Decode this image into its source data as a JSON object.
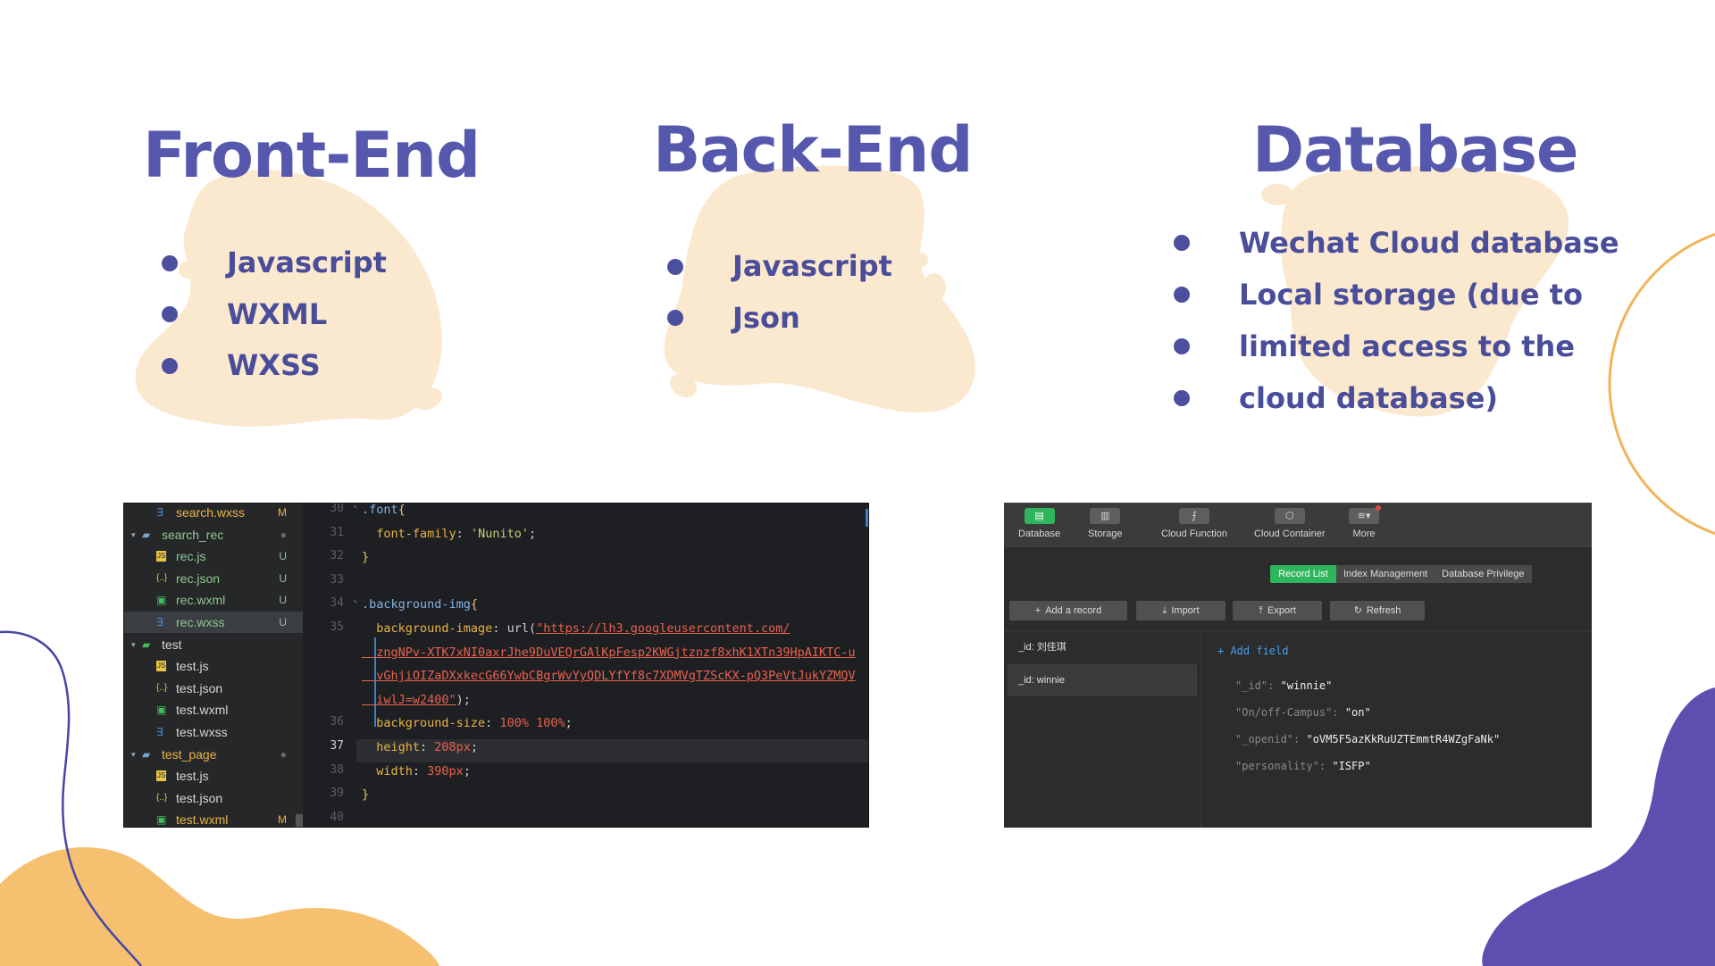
{
  "colors": {
    "heading": "#5558ad",
    "bullet_text": "#4a4d99",
    "blob": "#fbe9cf",
    "orange_blob": "#f5c06f",
    "purple_blob": "#5d4fb0",
    "line_blue": "#4746a7",
    "line_orange": "#f2b35a"
  },
  "sections": [
    {
      "title": "Front-End",
      "items": [
        "Javascript",
        "WXML",
        "WXSS"
      ]
    },
    {
      "title": "Back-End",
      "items": [
        "Javascript",
        "Json"
      ]
    },
    {
      "title": "Database",
      "items": [
        "Wechat Cloud database",
        "Local storage (due to",
        "limited access to the",
        "cloud database)"
      ]
    }
  ],
  "editor": {
    "tree": [
      {
        "name": "search.wxss",
        "icon": "css-file-icon",
        "glyph": "∃",
        "status": "M",
        "color": "#e9b545",
        "icon_color": "#4a8fe0",
        "indent": 1
      },
      {
        "name": "search_rec",
        "icon": "folder-icon",
        "glyph": "▰",
        "status": "●",
        "color": "#8ec98e",
        "icon_color": "#7aa6c9",
        "indent": 0,
        "arrow": "▾"
      },
      {
        "name": "rec.js",
        "icon": "js-file-icon",
        "glyph": "JS",
        "status": "U",
        "color": "#8ec98e",
        "icon_color": "#e9c545",
        "indent": 1
      },
      {
        "name": "rec.json",
        "icon": "json-file-icon",
        "glyph": "{..}",
        "status": "U",
        "color": "#8ec98e",
        "icon_color": "#e9c545",
        "indent": 1
      },
      {
        "name": "rec.wxml",
        "icon": "wxml-file-icon",
        "glyph": "▣",
        "status": "U",
        "color": "#8ec98e",
        "icon_color": "#3fbf5a",
        "indent": 1
      },
      {
        "name": "rec.wxss",
        "icon": "css-file-icon",
        "glyph": "∃",
        "status": "U",
        "color": "#8ec98e",
        "icon_color": "#4a8fe0",
        "indent": 1,
        "selected": true
      },
      {
        "name": "test",
        "icon": "folder-icon",
        "glyph": "▰",
        "status": "",
        "color": "#d6d6d6",
        "icon_color": "#3fbf5a",
        "indent": 0,
        "arrow": "▾"
      },
      {
        "name": "test.js",
        "icon": "js-file-icon",
        "glyph": "JS",
        "status": "",
        "color": "#d6d6d6",
        "icon_color": "#e9c545",
        "indent": 1
      },
      {
        "name": "test.json",
        "icon": "json-file-icon",
        "glyph": "{..}",
        "status": "",
        "color": "#d6d6d6",
        "icon_color": "#e9c545",
        "indent": 1
      },
      {
        "name": "test.wxml",
        "icon": "wxml-file-icon",
        "glyph": "▣",
        "status": "",
        "color": "#d6d6d6",
        "icon_color": "#3fbf5a",
        "indent": 1
      },
      {
        "name": "test.wxss",
        "icon": "css-file-icon",
        "glyph": "∃",
        "status": "",
        "color": "#d6d6d6",
        "icon_color": "#4a8fe0",
        "indent": 1
      },
      {
        "name": "test_page",
        "icon": "folder-icon",
        "glyph": "▰",
        "status": "●",
        "color": "#e9b545",
        "icon_color": "#7aa6c9",
        "indent": 0,
        "arrow": "▾"
      },
      {
        "name": "test.js",
        "icon": "js-file-icon",
        "glyph": "JS",
        "status": "",
        "color": "#d6d6d6",
        "icon_color": "#e9c545",
        "indent": 1
      },
      {
        "name": "test.json",
        "icon": "json-file-icon",
        "glyph": "{..}",
        "status": "",
        "color": "#d6d6d6",
        "icon_color": "#e9c545",
        "indent": 1
      },
      {
        "name": "test.wxml",
        "icon": "wxml-file-icon",
        "glyph": "▣",
        "status": "M",
        "color": "#e9b545",
        "icon_color": "#3fbf5a",
        "indent": 1
      }
    ],
    "line_numbers": [
      "30",
      "31",
      "32",
      "33",
      "34",
      "35",
      "",
      "",
      "",
      "36",
      "37",
      "38",
      "39",
      "40"
    ],
    "current_line": "37",
    "code": [
      {
        "tokens": [
          {
            "t": ".font",
            "c": "c-sel"
          },
          {
            "t": "{",
            "c": "c-br"
          }
        ]
      },
      {
        "tokens": [
          {
            "t": "  font-family",
            "c": "c-prop"
          },
          {
            "t": ": ",
            "c": "c-punc"
          },
          {
            "t": "'Nunito'",
            "c": "c-str"
          },
          {
            "t": ";",
            "c": "c-punc"
          }
        ]
      },
      {
        "tokens": [
          {
            "t": "}",
            "c": "c-br"
          }
        ]
      },
      {
        "tokens": []
      },
      {
        "tokens": [
          {
            "t": ".background-img",
            "c": "c-sel"
          },
          {
            "t": "{",
            "c": "c-br"
          }
        ]
      },
      {
        "tokens": [
          {
            "t": "  background-image",
            "c": "c-prop"
          },
          {
            "t": ": url(",
            "c": "c-punc"
          },
          {
            "t": "\"https://lh3.googleusercontent.com/",
            "c": "c-url"
          }
        ]
      },
      {
        "tokens": [
          {
            "t": "  zngNPv-XTK7xNI0axrJhe9DuVEQrGAlKpFesp2KWGjtznzf8xhK1XTn39HpAIKTC-u",
            "c": "c-url"
          }
        ]
      },
      {
        "tokens": [
          {
            "t": "  vGhjiOIZaDXxkecG66YwbCBgrWvYyQDLYfYf8c7XDMVgTZScKX-pQ3PeVtJukYZMQV",
            "c": "c-url"
          }
        ]
      },
      {
        "tokens": [
          {
            "t": "  iwlJ=w2400\"",
            "c": "c-url"
          },
          {
            "t": ");",
            "c": "c-punc"
          }
        ]
      },
      {
        "tokens": [
          {
            "t": "  background-size",
            "c": "c-prop"
          },
          {
            "t": ": ",
            "c": "c-punc"
          },
          {
            "t": "100% 100%",
            "c": "c-num"
          },
          {
            "t": ";",
            "c": "c-punc"
          }
        ]
      },
      {
        "tokens": [
          {
            "t": "  height",
            "c": "c-prop"
          },
          {
            "t": ": ",
            "c": "c-punc"
          },
          {
            "t": "208px",
            "c": "c-num"
          },
          {
            "t": ";",
            "c": "c-punc"
          }
        ]
      },
      {
        "tokens": [
          {
            "t": "  width",
            "c": "c-prop"
          },
          {
            "t": ": ",
            "c": "c-punc"
          },
          {
            "t": "390px",
            "c": "c-num"
          },
          {
            "t": ";",
            "c": "c-punc"
          }
        ]
      },
      {
        "tokens": [
          {
            "t": "}",
            "c": "c-br"
          }
        ]
      },
      {
        "tokens": []
      }
    ]
  },
  "db": {
    "toolbar": [
      {
        "label": "Database",
        "icon": "database-icon",
        "glyph": "▤",
        "active": true
      },
      {
        "label": "Storage",
        "icon": "storage-icon",
        "glyph": "▥",
        "active": false
      },
      {
        "label": "Cloud Function",
        "icon": "cloud-function-icon",
        "glyph": "⨍",
        "active": false
      },
      {
        "label": "Cloud Container",
        "icon": "cloud-container-icon",
        "glyph": "⬡",
        "active": false
      },
      {
        "label": "More",
        "icon": "more-icon",
        "glyph": "≋▾",
        "active": false
      }
    ],
    "tabs": [
      {
        "label": "Record List",
        "active": true
      },
      {
        "label": "Index Management",
        "active": false
      },
      {
        "label": "Database Privilege",
        "active": false
      }
    ],
    "buttons": [
      {
        "label": "Add a record",
        "icon": "plus-icon",
        "glyph": "+"
      },
      {
        "label": "Import",
        "icon": "import-icon",
        "glyph": "⤓"
      },
      {
        "label": "Export",
        "icon": "export-icon",
        "glyph": "⤒"
      },
      {
        "label": "Refresh",
        "icon": "refresh-icon",
        "glyph": "↻"
      }
    ],
    "records": [
      {
        "label": "_id: 刘佳琪",
        "selected": false
      },
      {
        "label": "_id: winnie",
        "selected": true
      }
    ],
    "add_field": "+ Add field",
    "fields": [
      {
        "key": "\"_id\"",
        "value": "\"winnie\""
      },
      {
        "key": "\"On/off-Campus\"",
        "value": "\"on\""
      },
      {
        "key": "\"_openid\"",
        "value": "\"oVM5F5azKkRuUZTEmmtR4WZgFaNk\""
      },
      {
        "key": "\"personality\"",
        "value": "\"ISFP\""
      }
    ]
  }
}
